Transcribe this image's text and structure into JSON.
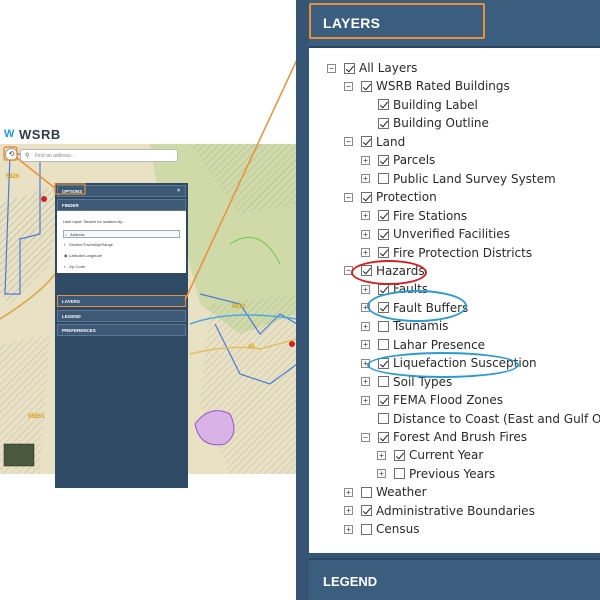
{
  "app": {
    "logo_text": "WSRB",
    "search_placeholder": "Find an address..."
  },
  "mini_panel": {
    "options_label": "OPTIONS",
    "close_label": "×",
    "finder_label": "FINDER",
    "finder_prompt": "User input: Search for location by...",
    "finder_options": [
      "Address",
      "Section/Township/Range",
      "Latitude/Longitude",
      "Zip Code"
    ],
    "layers_label": "LAYERS",
    "legend_label": "LEGEND",
    "preferences_label": "PREFERENCES"
  },
  "map": {
    "labels": [
      "5826",
      "5833",
      "45",
      "95851"
    ]
  },
  "layers_panel": {
    "title": "LAYERS",
    "legend_title": "LEGEND",
    "tree": [
      {
        "label": "All Layers",
        "checked": true,
        "toggle": "minus",
        "level": 0
      },
      {
        "label": "WSRB Rated Buildings",
        "checked": true,
        "toggle": "minus",
        "level": 1
      },
      {
        "label": "Building Label",
        "checked": true,
        "toggle": "",
        "level": 2
      },
      {
        "label": "Building Outline",
        "checked": true,
        "toggle": "",
        "level": 2
      },
      {
        "label": "Land",
        "checked": true,
        "toggle": "minus",
        "level": 1
      },
      {
        "label": "Parcels",
        "checked": true,
        "toggle": "plus",
        "level": 2
      },
      {
        "label": "Public Land Survey System",
        "checked": false,
        "toggle": "plus",
        "level": 2
      },
      {
        "label": "Protection",
        "checked": true,
        "toggle": "minus",
        "level": 1
      },
      {
        "label": "Fire Stations",
        "checked": true,
        "toggle": "plus",
        "level": 2
      },
      {
        "label": "Unverified Facilities",
        "checked": true,
        "toggle": "plus",
        "level": 2
      },
      {
        "label": "Fire Protection Districts",
        "checked": true,
        "toggle": "plus",
        "level": 2
      },
      {
        "label": "Hazards",
        "checked": true,
        "toggle": "minus",
        "level": 1
      },
      {
        "label": "Faults",
        "checked": true,
        "toggle": "plus",
        "level": 2
      },
      {
        "label": "Fault Buffers",
        "checked": true,
        "toggle": "plus",
        "level": 2
      },
      {
        "label": "Tsunamis",
        "checked": false,
        "toggle": "plus",
        "level": 2
      },
      {
        "label": "Lahar Presence",
        "checked": false,
        "toggle": "plus",
        "level": 2
      },
      {
        "label": "Liquefaction Susception",
        "checked": true,
        "toggle": "plus",
        "level": 2
      },
      {
        "label": "Soil Types",
        "checked": false,
        "toggle": "plus",
        "level": 2
      },
      {
        "label": "FEMA Flood Zones",
        "checked": true,
        "toggle": "plus",
        "level": 2
      },
      {
        "label": "Distance to Coast (East and Gulf Only)",
        "checked": false,
        "toggle": "",
        "level": 2
      },
      {
        "label": "Forest And Brush Fires",
        "checked": true,
        "toggle": "minus",
        "level": 2
      },
      {
        "label": "Current Year",
        "checked": true,
        "toggle": "plus",
        "level": 3
      },
      {
        "label": "Previous Years",
        "checked": false,
        "toggle": "plus",
        "level": 3
      },
      {
        "label": "Weather",
        "checked": false,
        "toggle": "plus",
        "level": 1
      },
      {
        "label": "Administrative Boundaries",
        "checked": true,
        "toggle": "plus",
        "level": 1
      },
      {
        "label": "Census",
        "checked": false,
        "toggle": "plus",
        "level": 1
      }
    ]
  },
  "colors": {
    "panel": "#365574",
    "callout": "#e8913a",
    "highlight_red": "#d42020",
    "highlight_blue": "#2a9bd0"
  },
  "icons": [
    "back-arrow-icon",
    "search-icon",
    "close-icon",
    "expand-icon",
    "collapse-icon",
    "checkbox-icon"
  ]
}
